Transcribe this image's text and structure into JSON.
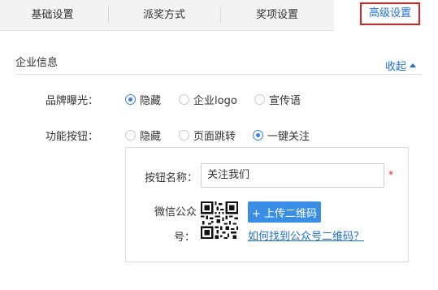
{
  "tabs": [
    {
      "label": "基础设置"
    },
    {
      "label": "派奖方式"
    },
    {
      "label": "奖项设置"
    },
    {
      "label": "高级设置",
      "active": true
    }
  ],
  "section": {
    "title": "企业信息",
    "collapse_label": "收起"
  },
  "brand_exposure": {
    "label": "品牌曝光：",
    "options": [
      {
        "label": "隐藏",
        "checked": true
      },
      {
        "label": "企业logo",
        "checked": false
      },
      {
        "label": "宣传语",
        "checked": false
      }
    ]
  },
  "function_button": {
    "label": "功能按钮：",
    "options": [
      {
        "label": "隐藏",
        "checked": false
      },
      {
        "label": "页面跳转",
        "checked": false
      },
      {
        "label": "一键关注",
        "checked": true
      }
    ]
  },
  "follow_panel": {
    "button_name_label": "按钮名称：",
    "button_name_value": "关注我们",
    "required_mark": "*",
    "wechat_label_line1": "微信公众",
    "wechat_label_line2": "号：",
    "upload_button_label": "+ 上传二维码",
    "help_link": "如何找到公众号二维码？"
  },
  "colors": {
    "accent": "#1e6fd9",
    "radio": "#3a7ff0",
    "button": "#3a8ee6",
    "highlight": "#e0201f"
  }
}
